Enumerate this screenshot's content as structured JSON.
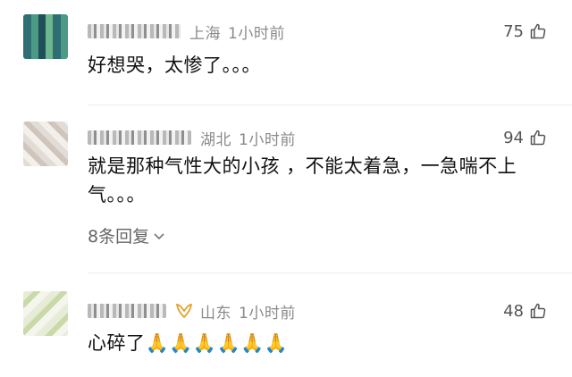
{
  "comments": [
    {
      "location": "上海",
      "time": "1小时前",
      "likes": "75",
      "text": "好想哭，太惨了。。。",
      "icon": "thumbs-up-icon"
    },
    {
      "location": "湖北",
      "time": "1小时前",
      "likes": "94",
      "text": "就是那种气性大的小孩 ，不能太着急，一急喘不上气。。。",
      "replies": "8条回复",
      "icon": "thumbs-up-icon"
    },
    {
      "location": "山东",
      "time": "1小时前",
      "likes": "48",
      "text": "心碎了🙏🙏🙏🙏🙏🙏",
      "badge": "VIP",
      "icon": "thumbs-up-icon"
    }
  ],
  "colors": {
    "meta_gray": "#8a8a8a",
    "badge_gold": "#e2a12b",
    "divider": "#ededed"
  }
}
